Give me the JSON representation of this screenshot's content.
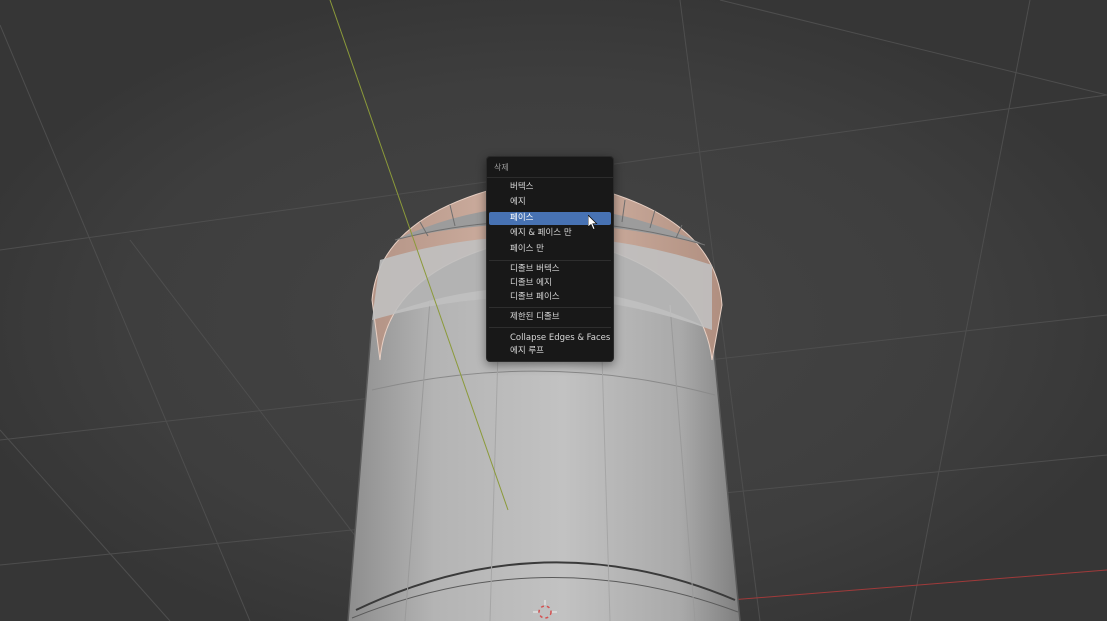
{
  "menu": {
    "title": "삭제",
    "items": [
      {
        "label": "버텍스",
        "active": false
      },
      {
        "label": "에지",
        "active": false
      },
      {
        "label": "페이스",
        "active": true
      },
      {
        "label": "에지 & 페이스 만",
        "active": false
      },
      {
        "label": "페이스 만",
        "active": false
      },
      {
        "label": "디졸브 버텍스",
        "active": false
      },
      {
        "label": "디졸브 에지",
        "active": false
      },
      {
        "label": "디졸브 페이스",
        "active": false
      },
      {
        "label": "제한된 디졸브",
        "active": false
      },
      {
        "label": "Collapse Edges & Faces",
        "active": false
      },
      {
        "label": "에지 루프",
        "active": false
      }
    ]
  },
  "colors": {
    "viewport_bg": "#3d3d3d",
    "menu_bg": "#181818",
    "highlight": "#4772b3",
    "selected_faces": "#c9aa9a",
    "y_axis": "#8b9a3a",
    "x_axis": "#b03a3a"
  },
  "icons": {
    "cursor": "arrow-pointer-icon",
    "origin": "3d-cursor-icon"
  }
}
